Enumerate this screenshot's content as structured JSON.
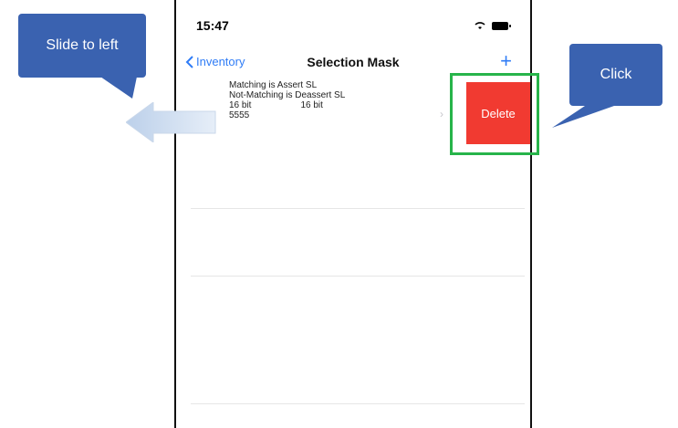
{
  "status_bar": {
    "time": "15:47"
  },
  "navbar": {
    "back_label": "Inventory",
    "title": "Selection Mask",
    "add_symbol": "+"
  },
  "row": {
    "line1": "Matching is Assert SL",
    "line2": "Not-Matching is Deassert SL",
    "bit_a": "16 bit",
    "bit_b": "16 bit",
    "mask": "5555",
    "delete_label": "Delete"
  },
  "annotations": {
    "left_callout": "Slide to left",
    "right_callout": "Click"
  },
  "colors": {
    "accent": "#2f7cf6",
    "delete_red": "#f13a31",
    "callout_blue": "#3a62b0",
    "highlight_green": "#27b44a"
  }
}
